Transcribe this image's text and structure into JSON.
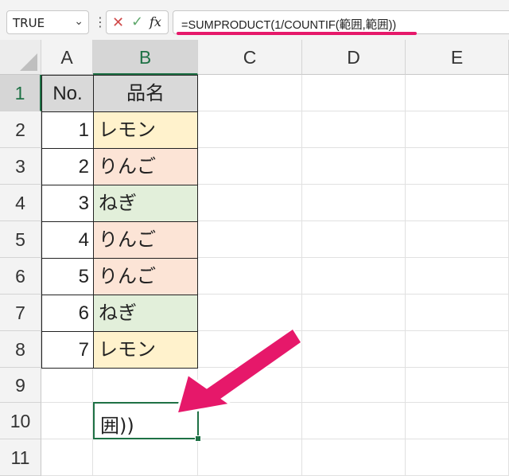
{
  "formula_bar": {
    "name_box": "TRUE",
    "dropdown_icon": "chevron-down-icon",
    "more_icon": "vertical-ellipsis-icon",
    "cancel_icon": "close-icon",
    "enter_icon": "checkmark-icon",
    "function_icon": "fx",
    "formula": "=SUMPRODUCT(1/COUNTIF(範囲,範囲))",
    "highlight_color": "#e6186a"
  },
  "columns": [
    "A",
    "B",
    "C",
    "D",
    "E"
  ],
  "selected_column": "B",
  "rows": [
    "1",
    "2",
    "3",
    "4",
    "5",
    "6",
    "7",
    "8",
    "9",
    "10",
    "11"
  ],
  "selected_row": "1",
  "table": {
    "header_no": "No.",
    "header_name": "品名",
    "items": [
      {
        "no": "1",
        "name": "レモン",
        "color": "#fff2cc"
      },
      {
        "no": "2",
        "name": "りんご",
        "color": "#fce4d6"
      },
      {
        "no": "3",
        "name": "ねぎ",
        "color": "#e2efda"
      },
      {
        "no": "4",
        "name": "りんご",
        "color": "#fce4d6"
      },
      {
        "no": "5",
        "name": "りんご",
        "color": "#fce4d6"
      },
      {
        "no": "6",
        "name": "ねぎ",
        "color": "#e2efda"
      },
      {
        "no": "7",
        "name": "レモン",
        "color": "#fff2cc"
      }
    ]
  },
  "active_cell_text": "囲))",
  "arrow_color": "#e6186a"
}
